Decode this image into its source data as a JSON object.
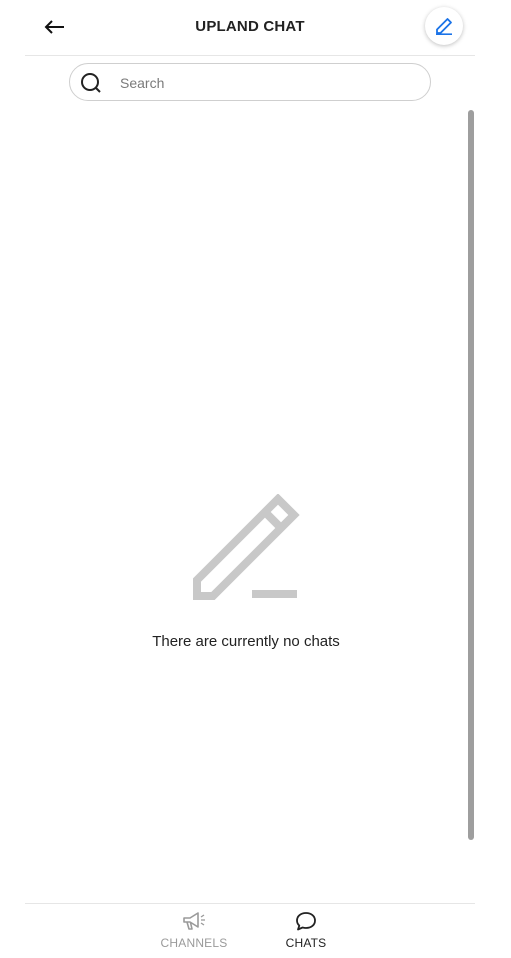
{
  "header": {
    "title": "UPLAND CHAT",
    "back_icon": "arrow-left-icon",
    "compose_icon": "pencil-icon",
    "compose_color": "#1a73e8"
  },
  "search": {
    "placeholder": "Search",
    "value": "",
    "icon": "search-icon"
  },
  "empty_state": {
    "icon": "pencil-icon",
    "message": "There are currently no chats"
  },
  "tabs": [
    {
      "label": "CHANNELS",
      "icon": "megaphone-icon",
      "active": false
    },
    {
      "label": "CHATS",
      "icon": "chat-bubble-icon",
      "active": true
    }
  ]
}
